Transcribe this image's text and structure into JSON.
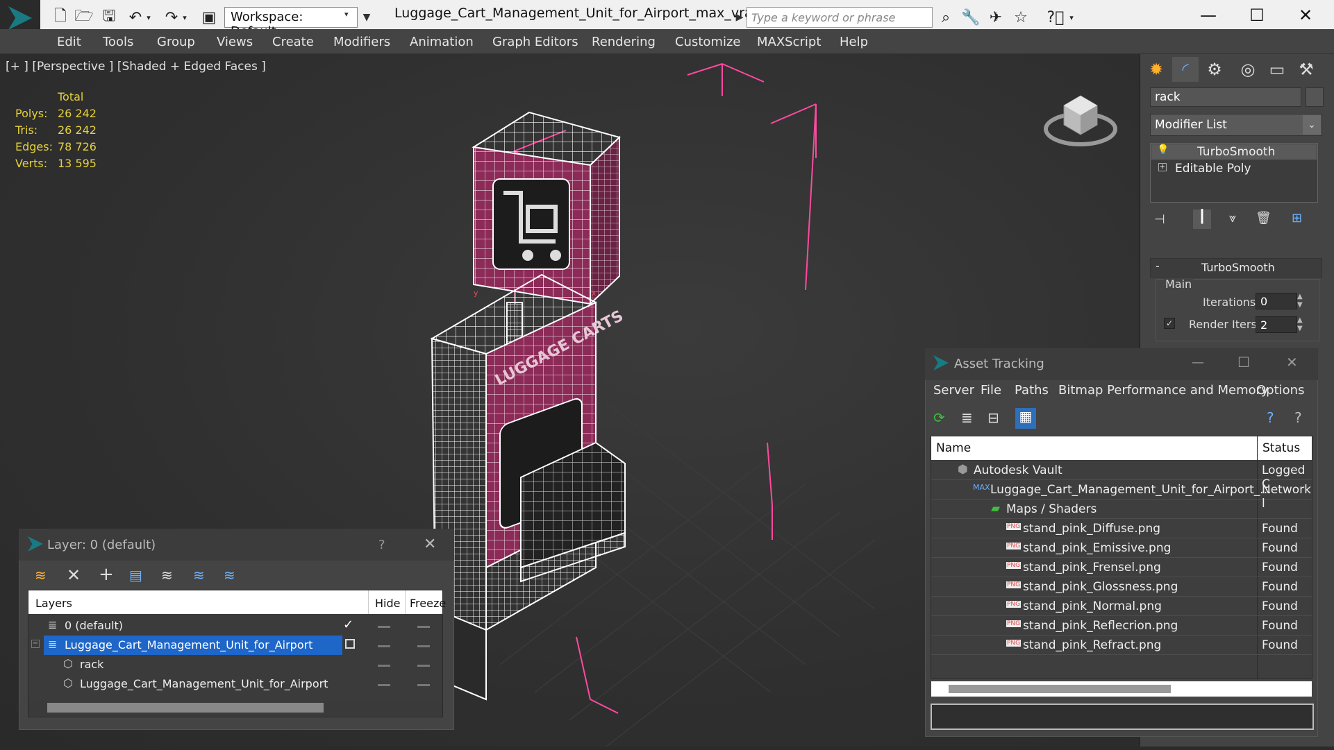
{
  "titlebar": {
    "workspace_label": "Workspace: Default",
    "document_title": "Luggage_Cart_Management_Unit_for_Airport_max_vray.max",
    "search_placeholder": "Type a keyword or phrase",
    "icons": [
      "new-file-icon",
      "open-folder-icon",
      "save-icon",
      "undo-icon",
      "redo-icon",
      "project-folder-icon",
      "binoculars-icon",
      "wrench-icon",
      "favorites-star-icon",
      "help-icon"
    ]
  },
  "menubar": [
    "Edit",
    "Tools",
    "Group",
    "Views",
    "Create",
    "Modifiers",
    "Animation",
    "Graph Editors",
    "Rendering",
    "Customize",
    "MAXScript",
    "Help"
  ],
  "viewport": {
    "label": "[+ ] [Perspective ] [Shaded + Edged Faces ]",
    "stats": {
      "header": "Total",
      "rows": [
        {
          "label": "Polys:",
          "value": "26 242"
        },
        {
          "label": "Tris:",
          "value": "26 242"
        },
        {
          "label": "Edges:",
          "value": "78 726"
        },
        {
          "label": "Verts:",
          "value": "13 595"
        }
      ]
    },
    "model_text": "LUGGAGE CARTS",
    "colors": {
      "accent": "#ff4aa0",
      "pink": "#8c2b57",
      "wire": "#ffffff"
    }
  },
  "command_panel": {
    "object_name": "rack",
    "modifier_list": "Modifier List",
    "stack": [
      "TurboSmooth",
      "Editable Poly"
    ],
    "rollout_title": "TurboSmooth",
    "group_label": "Main",
    "iterations_label": "Iterations:",
    "iterations_value": "0",
    "render_iters_label": "Render Iters:",
    "render_iters_value": "2",
    "render_iters_checked": true
  },
  "asset_tracking": {
    "title": "Asset Tracking",
    "menu": [
      "Server",
      "File",
      "Paths",
      "Bitmap Performance and Memory",
      "Options"
    ],
    "columns": [
      "Name",
      "Status"
    ],
    "rows": [
      {
        "name": "Autodesk Vault",
        "status": "Logged C"
      },
      {
        "name": "Luggage_Cart_Management_Unit_for_Airport_...",
        "status": "Network l"
      },
      {
        "name": "Maps / Shaders",
        "status": ""
      },
      {
        "name": "stand_pink_Diffuse.png",
        "status": "Found"
      },
      {
        "name": "stand_pink_Emissive.png",
        "status": "Found"
      },
      {
        "name": "stand_pink_Frensel.png",
        "status": "Found"
      },
      {
        "name": "stand_pink_Glossness.png",
        "status": "Found"
      },
      {
        "name": "stand_pink_Normal.png",
        "status": "Found"
      },
      {
        "name": "stand_pink_Reflecrion.png",
        "status": "Found"
      },
      {
        "name": "stand_pink_Refract.png",
        "status": "Found"
      }
    ]
  },
  "layer_window": {
    "title": "Layer: 0 (default)",
    "help": "?",
    "columns": [
      "Layers",
      "Hide",
      "Freeze"
    ],
    "rows": [
      {
        "name": "0 (default)",
        "active": true
      },
      {
        "name": "Luggage_Cart_Management_Unit_for_Airport",
        "selected": true
      },
      {
        "name": "rack"
      },
      {
        "name": "Luggage_Cart_Management_Unit_for_Airport"
      }
    ]
  }
}
